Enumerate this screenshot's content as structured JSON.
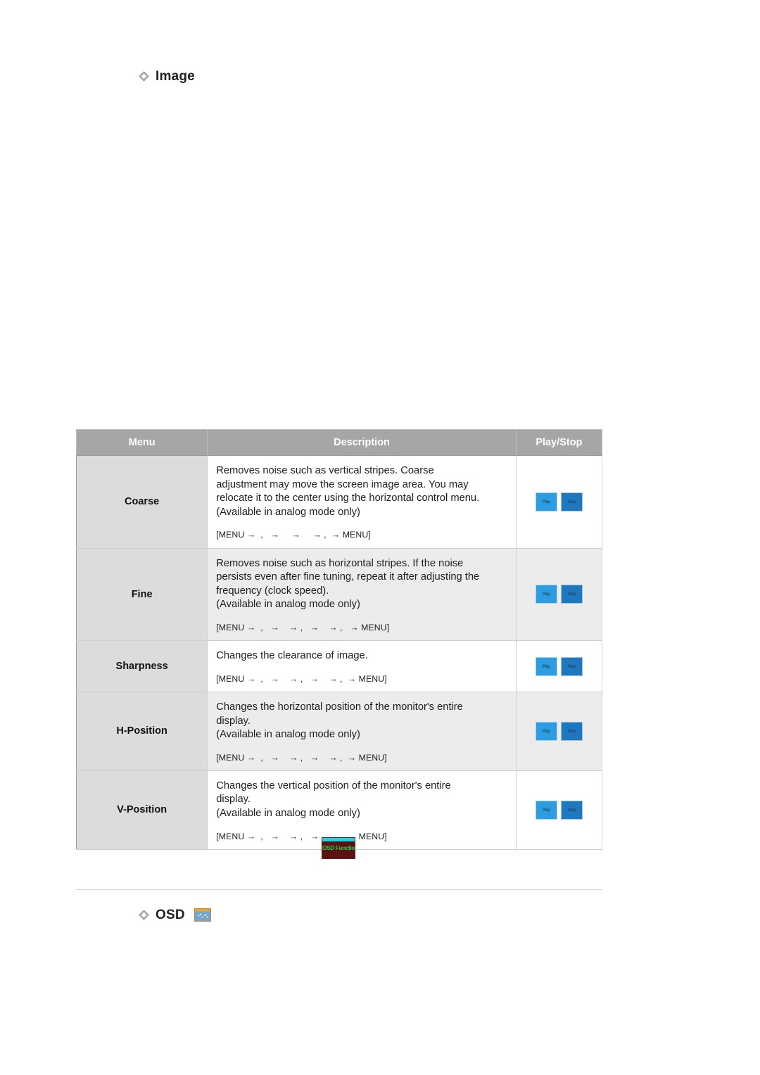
{
  "sections": {
    "image": {
      "label": "Image",
      "icon": "diamond-bullet-icon"
    },
    "osd": {
      "label": "OSD",
      "icon": "diamond-bullet-icon",
      "thumb": "osd-preview-thumbnail"
    }
  },
  "table": {
    "headers": {
      "menu": "Menu",
      "description": "Description",
      "playstop": "Play/Stop"
    },
    "rows": [
      {
        "menu": "Coarse",
        "lines": [
          "Removes noise such as vertical stripes. Coarse",
          "adjustment may move the screen image area. You may",
          "relocate it to the center using the horizontal control menu.",
          "(Available in analog mode only)"
        ],
        "path": "[MENU →  ,   →     →     → ,  → MENU]",
        "play_label": "Play",
        "stop_label": "Stop"
      },
      {
        "menu": "Fine",
        "lines": [
          "Removes noise such as horizontal stripes. If the noise",
          "persists even after fine tuning, repeat it after adjusting the",
          "frequency (clock speed).",
          "(Available in analog mode only)"
        ],
        "path": "[MENU →  ,   →    → ,   →    → ,   → MENU]",
        "play_label": "Play",
        "stop_label": "Stop"
      },
      {
        "menu": "Sharpness",
        "lines": [
          "Changes the clearance of image."
        ],
        "path": "[MENU →  ,   →    → ,   →    → ,  → MENU]",
        "play_label": "Play",
        "stop_label": "Stop"
      },
      {
        "menu": "H-Position",
        "lines": [
          "Changes the horizontal position of the monitor's entire",
          "display.",
          "(Available in analog mode only)"
        ],
        "path": "[MENU →  ,   →    → ,   →    → ,  → MENU]",
        "play_label": "Play",
        "stop_label": "Stop"
      },
      {
        "menu": "V-Position",
        "lines": [
          "Changes the vertical position of the monitor's entire",
          "display.",
          "(Available in analog mode only)"
        ],
        "path": "[MENU →  ,   →    → ,   →    → ,  → MENU]",
        "play_label": "Play",
        "stop_label": "Stop"
      }
    ]
  },
  "function_badge": {
    "text": "OSD Function",
    "background": "#5c1212",
    "text_color": "#15d14a",
    "accent_color": "#12d8e8"
  },
  "colors": {
    "header_bg": "#a6a6a6",
    "menu_cell_bg": "#dcdcdc",
    "alt_row_bg": "#ececec",
    "play_button": "#2e9ce0",
    "stop_button": "#1f78bf"
  }
}
